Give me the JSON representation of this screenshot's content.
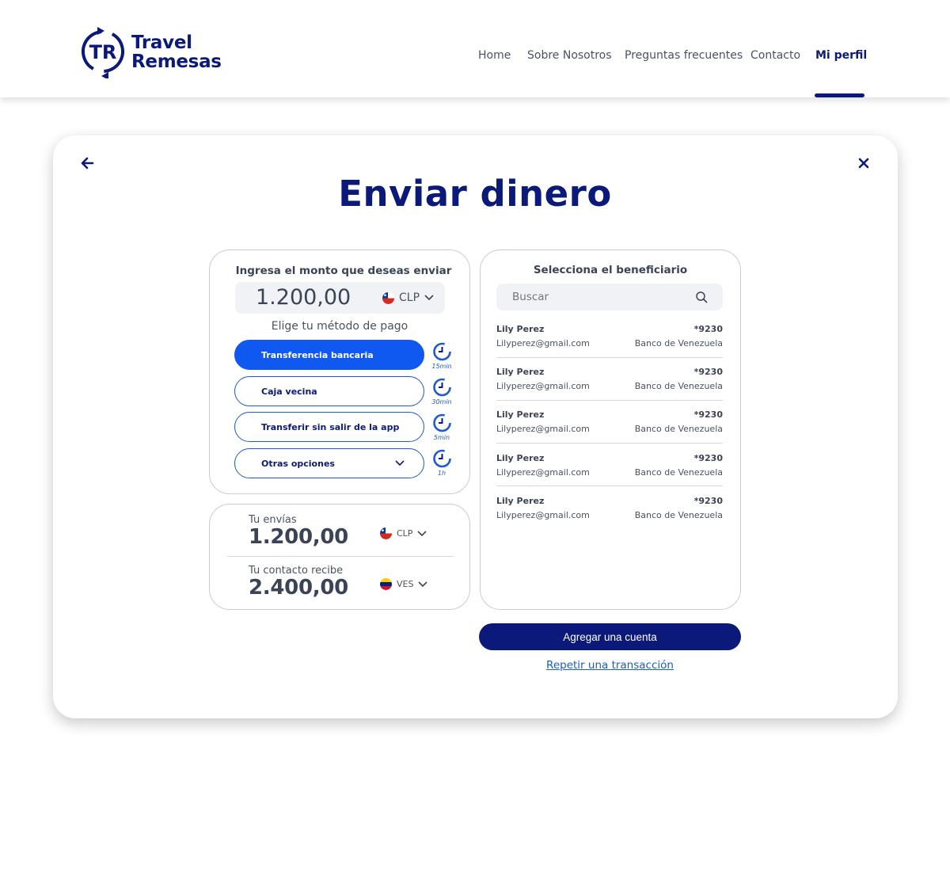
{
  "header": {
    "logo": {
      "line1": "Travel",
      "line2": "Remesas",
      "mark": "TR"
    },
    "nav": [
      {
        "label": "Home",
        "active": false
      },
      {
        "label": "Sobre Nosotros",
        "active": false
      },
      {
        "label": "Preguntas frecuentes",
        "active": false
      },
      {
        "label": "Contacto",
        "active": false
      },
      {
        "label": "Mi perfil",
        "active": true
      }
    ]
  },
  "page": {
    "title": "Enviar dinero",
    "back_icon": "arrow-left-icon",
    "close_icon": "close-icon"
  },
  "amount_panel": {
    "heading": "Ingresa el monto que deseas enviar",
    "amount": "1.200,00",
    "currency": "CLP",
    "method_label": "Elige tu método de pago",
    "methods": [
      {
        "label": "Transferencia bancaria",
        "time": "15min",
        "selected": true
      },
      {
        "label": "Caja vecina",
        "time": "30min",
        "selected": false
      },
      {
        "label": "Transferir sin salir de la app",
        "time": "5min",
        "selected": false
      },
      {
        "label": "Otras opciones",
        "time": "1h",
        "selected": false,
        "dropdown": true
      }
    ]
  },
  "summary": {
    "send_label": "Tu envías",
    "send_value": "1.200,00",
    "send_currency": "CLP",
    "receive_label": "Tu contacto recibe",
    "receive_value": "2.400,00",
    "receive_currency": "VES"
  },
  "beneficiary_panel": {
    "heading": "Selecciona el beneficiario",
    "search_placeholder": "Buscar",
    "items": [
      {
        "name": "Lily Perez",
        "email": "Lilyperez@gmail.com",
        "account": "*9230",
        "bank": "Banco de Venezuela"
      },
      {
        "name": "Lily Perez",
        "email": "Lilyperez@gmail.com",
        "account": "*9230",
        "bank": "Banco de Venezuela"
      },
      {
        "name": "Lily Perez",
        "email": "Lilyperez@gmail.com",
        "account": "*9230",
        "bank": "Banco de Venezuela"
      },
      {
        "name": "Lily Perez",
        "email": "Lilyperez@gmail.com",
        "account": "*9230",
        "bank": "Banco de Venezuela"
      },
      {
        "name": "Lily Perez",
        "email": "Lilyperez@gmail.com",
        "account": "*9230",
        "bank": "Banco de Venezuela"
      }
    ]
  },
  "actions": {
    "add_account": "Agregar una cuenta",
    "repeat_transaction": "Repetir una transacción"
  },
  "colors": {
    "brand_navy": "#0b1a7a",
    "accent_blue": "#1059f0",
    "text_gray": "#3b4456"
  }
}
